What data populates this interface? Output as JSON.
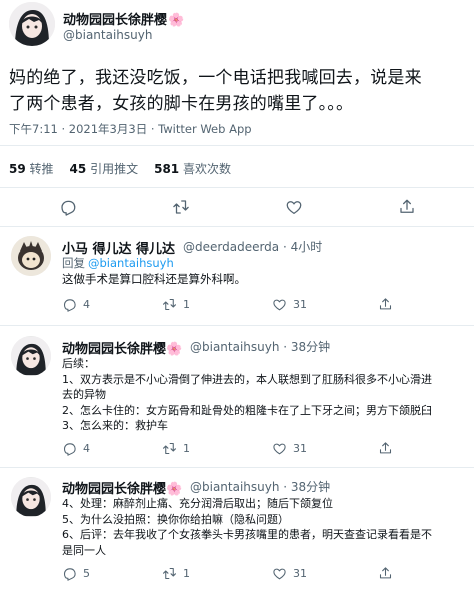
{
  "main_tweet": {
    "name": "动物园园长徐胖樱",
    "name_emoji": "🌸",
    "handle": "@biantaihsuyh",
    "text_line1": "妈的绝了，我还没吃饭，一个电话把我喊回去，说是来",
    "text_line2": "了两个患者，女孩的脚卡在男孩的嘴里了。。。",
    "meta": "下午7:11 · 2021年3月3日 · Twitter Web App",
    "stats": {
      "retweets_count": "59",
      "retweets_label": "转推",
      "quotes_count": "45",
      "quotes_label": "引用推文",
      "likes_count": "581",
      "likes_label": "喜欢次数"
    }
  },
  "replies": [
    {
      "name": "小马 得儿达 得儿达",
      "handle": "@deerdadeerda · 4小时",
      "reply_to_prefix": "回复",
      "reply_to_handle": "@biantaihsuyh",
      "lines": [
        "这做手术是算口腔科还是算外科啊。"
      ],
      "reply_count": "4",
      "retweet_count": "1",
      "like_count": "31"
    },
    {
      "name": "动物园园长徐胖樱",
      "name_emoji": "🌸",
      "handle": "@biantaihsuyh · 38分钟",
      "lines": [
        "后续：",
        "1、双方表示是不小心滑倒了伸进去的，本人联想到了肛肠科很多不小心滑进",
        "去的异物",
        "2、怎么卡住的：女方跖骨和趾骨处的粗隆卡在了上下牙之间；男方下颌脱臼",
        "3、怎么来的：救护车"
      ],
      "reply_count": "4",
      "retweet_count": "1",
      "like_count": "31"
    },
    {
      "name": "动物园园长徐胖樱",
      "name_emoji": "🌸",
      "handle": "@biantaihsuyh · 38分钟",
      "lines": [
        "4、处理：麻醉剂止痛、充分润滑后取出；随后下颌复位",
        "5、为什么没拍照：换你你给拍嘛（隐私问题）",
        "6、后评：去年我收了个女孩拳头卡男孩嘴里的患者，明天查查记录看看是不",
        "是同一人"
      ],
      "reply_count": "5",
      "retweet_count": "1",
      "like_count": "31"
    }
  ],
  "colors": {
    "link": "#1d9bf0",
    "muted": "#536471",
    "text": "#0f1419",
    "divider": "#e6ecf0"
  }
}
